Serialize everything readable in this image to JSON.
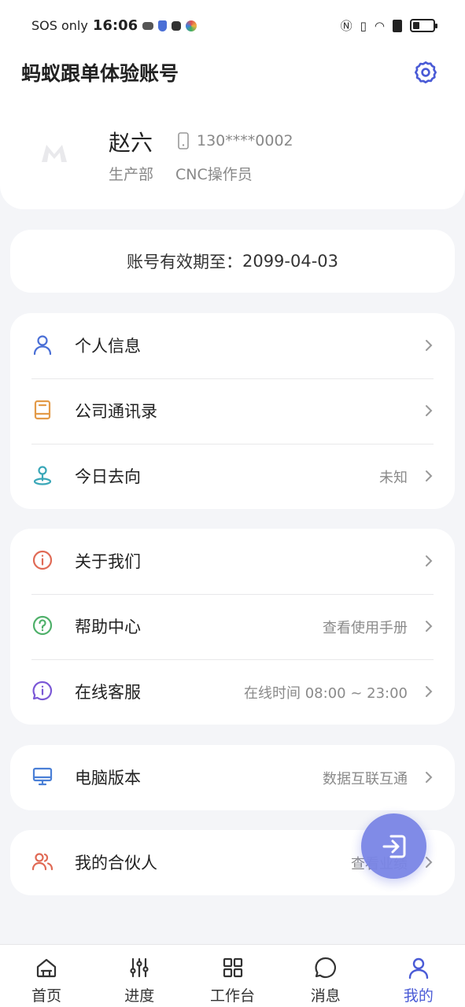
{
  "status_bar": {
    "carrier": "SOS only",
    "time": "16:06",
    "battery_level": 0.25
  },
  "header": {
    "title": "蚂蚁跟单体验账号",
    "settings_icon": "gear-icon",
    "avatar_icon": "logo-m-icon",
    "user": {
      "name": "赵六",
      "phone": "130****0002",
      "department": "生产部",
      "role": "CNC操作员"
    }
  },
  "validity": {
    "label": "账号有效期至：",
    "date": "2099-04-03"
  },
  "menu_groups": [
    {
      "items": [
        {
          "label": "个人信息",
          "value": "",
          "icon": "person-icon",
          "color": "#4a6fd6"
        },
        {
          "label": "公司通讯录",
          "value": "",
          "icon": "book-icon",
          "color": "#e39a48"
        },
        {
          "label": "今日去向",
          "value": "未知",
          "icon": "location-pin-icon",
          "color": "#3aa7b8"
        }
      ]
    },
    {
      "items": [
        {
          "label": "关于我们",
          "value": "",
          "icon": "info-icon",
          "color": "#e06a55"
        },
        {
          "label": "帮助中心",
          "value": "查看使用手册",
          "icon": "question-icon",
          "color": "#4fb06a"
        },
        {
          "label": "在线客服",
          "value": "在线时间 08:00 ~ 23:00",
          "icon": "chat-info-icon",
          "color": "#7b58d6"
        }
      ]
    },
    {
      "items": [
        {
          "label": "电脑版本",
          "value": "数据互联互通",
          "icon": "monitor-icon",
          "color": "#4a7fd6"
        }
      ]
    },
    {
      "items": [
        {
          "label": "我的合伙人",
          "value": "查看业绩",
          "icon": "partners-icon",
          "color": "#e06a55"
        }
      ]
    }
  ],
  "fab": {
    "icon": "logout-icon",
    "color": "#7a85e6"
  },
  "tabs": [
    {
      "label": "首页",
      "icon": "home-icon",
      "active": false
    },
    {
      "label": "进度",
      "icon": "sliders-icon",
      "active": false
    },
    {
      "label": "工作台",
      "icon": "grid-icon",
      "active": false
    },
    {
      "label": "消息",
      "icon": "message-icon",
      "active": false
    },
    {
      "label": "我的",
      "icon": "user-icon",
      "active": true
    }
  ],
  "colors": {
    "accent": "#4a5bd6",
    "background": "#f4f5f8"
  }
}
